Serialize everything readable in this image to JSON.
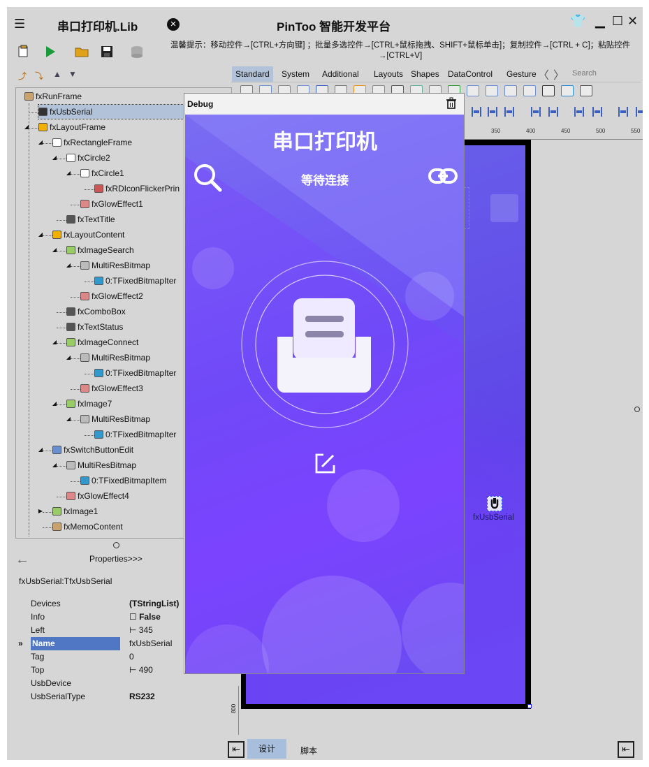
{
  "titlebar": {
    "doc_title": "串口打印机.Lib",
    "app_title": "PinToo 智能开发平台"
  },
  "hint": "温馨提示：移动控件→[CTRL+方向键] ；批量多选控件→[CTRL+鼠标拖拽、SHIFT+鼠标单击]；复制控件→[CTRL + C]；粘贴控件→[CTRL+V]",
  "palette": {
    "tabs": [
      "Standard",
      "System",
      "Additional",
      "Layouts",
      "Shapes",
      "DataControl",
      "Gesture"
    ],
    "search_placeholder": "Search"
  },
  "tree": {
    "nodes": [
      {
        "label": "fxRunFrame",
        "depth": 0,
        "exp": "open"
      },
      {
        "label": "fxUsbSerial",
        "depth": 1,
        "exp": "",
        "selected": true
      },
      {
        "label": "fxLayoutFrame",
        "depth": 1,
        "exp": "open"
      },
      {
        "label": "fxRectangleFrame",
        "depth": 2,
        "exp": "open"
      },
      {
        "label": "fxCircle2",
        "depth": 3,
        "exp": "open"
      },
      {
        "label": "fxCircle1",
        "depth": 4,
        "exp": "open"
      },
      {
        "label": "fxRDIconFlickerPrin",
        "depth": 5,
        "exp": ""
      },
      {
        "label": "fxGlowEffect1",
        "depth": 4,
        "exp": ""
      },
      {
        "label": "fxTextTitle",
        "depth": 3,
        "exp": ""
      },
      {
        "label": "fxLayoutContent",
        "depth": 2,
        "exp": "open"
      },
      {
        "label": "fxImageSearch",
        "depth": 3,
        "exp": "open"
      },
      {
        "label": "MultiResBitmap",
        "depth": 4,
        "exp": "open"
      },
      {
        "label": "0:TFixedBitmapIter",
        "depth": 5,
        "exp": ""
      },
      {
        "label": "fxGlowEffect2",
        "depth": 4,
        "exp": ""
      },
      {
        "label": "fxComboBox",
        "depth": 3,
        "exp": ""
      },
      {
        "label": "fxTextStatus",
        "depth": 3,
        "exp": ""
      },
      {
        "label": "fxImageConnect",
        "depth": 3,
        "exp": "open"
      },
      {
        "label": "MultiResBitmap",
        "depth": 4,
        "exp": "open"
      },
      {
        "label": "0:TFixedBitmapIter",
        "depth": 5,
        "exp": ""
      },
      {
        "label": "fxGlowEffect3",
        "depth": 4,
        "exp": ""
      },
      {
        "label": "fxImage7",
        "depth": 3,
        "exp": "open"
      },
      {
        "label": "MultiResBitmap",
        "depth": 4,
        "exp": "open"
      },
      {
        "label": "0:TFixedBitmapIter",
        "depth": 5,
        "exp": ""
      },
      {
        "label": "fxSwitchButtonEdit",
        "depth": 2,
        "exp": "open"
      },
      {
        "label": "MultiResBitmap",
        "depth": 3,
        "exp": "open"
      },
      {
        "label": "0:TFixedBitmapItem",
        "depth": 4,
        "exp": ""
      },
      {
        "label": "fxGlowEffect4",
        "depth": 3,
        "exp": ""
      },
      {
        "label": "fxImage1",
        "depth": 2,
        "exp": "closed"
      },
      {
        "label": "fxMemoContent",
        "depth": 2,
        "exp": ""
      }
    ]
  },
  "properties": {
    "header": "Properties>>>",
    "object": "fxUsbSerial:TfxUsbSerial",
    "rows": [
      {
        "key": "Devices",
        "value": "(TStringList)",
        "bold": true
      },
      {
        "key": "Info",
        "value": "False",
        "bold": true,
        "check": true
      },
      {
        "key": "Left",
        "value": "345"
      },
      {
        "key": "Name",
        "value": "fxUsbSerial",
        "selected": true
      },
      {
        "key": "Tag",
        "value": "0"
      },
      {
        "key": "Top",
        "value": "490"
      },
      {
        "key": "UsbDevice",
        "value": ""
      },
      {
        "key": "UsbSerialType",
        "value": "RS232",
        "bold": true
      }
    ]
  },
  "ruler": {
    "labels": [
      "350",
      "400",
      "450",
      "500",
      "550"
    ],
    "v_label": "800"
  },
  "canvas": {
    "component_label": "fxUsbSerial"
  },
  "debug": {
    "title": "Debug",
    "app_title": "串口打印机",
    "status": "等待连接"
  },
  "bottom": {
    "design_tab": "设计",
    "script_tab": "脚本"
  },
  "colors": {
    "accent": "#b2c3d9",
    "selected_prop": "#4f77c4",
    "phone_grad_start": "#7a6df2",
    "phone_grad_end": "#7d45ff"
  }
}
